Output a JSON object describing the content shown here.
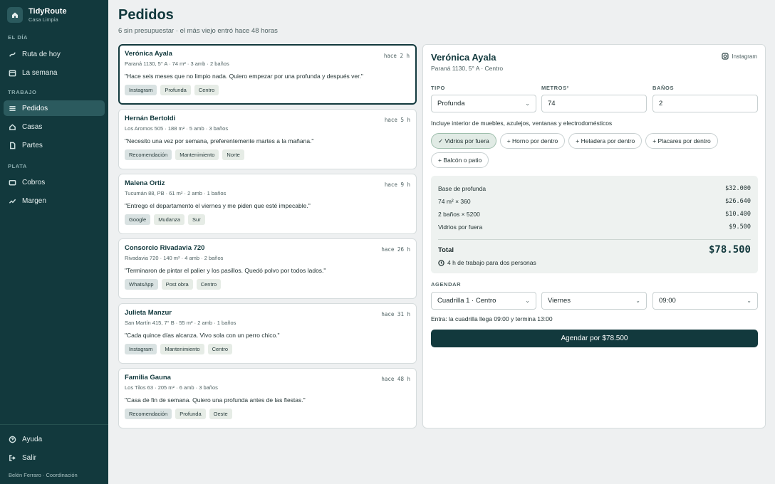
{
  "brand": {
    "name": "TidyRoute",
    "sub": "Casa Limpia"
  },
  "nav": {
    "sections": {
      "dia": "EL DÍA",
      "trabajo": "TRABAJO",
      "plata": "PLATA"
    },
    "ruta": "Ruta de hoy",
    "semana": "La semana",
    "pedidos": "Pedidos",
    "casas": "Casas",
    "partes": "Partes",
    "cobros": "Cobros",
    "margen": "Margen",
    "ayuda": "Ayuda",
    "salir": "Salir",
    "user": "Belén Ferraro · Coordinación"
  },
  "header": {
    "title": "Pedidos",
    "subtitle": "6 sin presupuestar · el más viejo entró hace 48 horas"
  },
  "requests": [
    {
      "name": "Verónica Ayala",
      "addr": "Paraná 1130, 5° A · 74 m² · 3 amb · 2 baños",
      "time": "hace  2  h",
      "quote": "\"Hace seis meses que no limpio nada. Quiero empezar por una profunda y después ver.\"",
      "tags": [
        "Instagram",
        "Profunda",
        "Centro"
      ]
    },
    {
      "name": "Hernán Bertoldi",
      "addr": "Los Aromos 505 · 188 m² · 5 amb · 3 baños",
      "time": "hace  5  h",
      "quote": "\"Necesito una vez por semana, preferentemente martes a la mañana.\"",
      "tags": [
        "Recomendación",
        "Mantenimiento",
        "Norte"
      ]
    },
    {
      "name": "Malena Ortiz",
      "addr": "Tucumán 88, PB · 61 m² · 2 amb · 1 baños",
      "time": "hace  9  h",
      "quote": "\"Entrego el departamento el viernes y me piden que esté impecable.\"",
      "tags": [
        "Google",
        "Mudanza",
        "Sur"
      ]
    },
    {
      "name": "Consorcio Rivadavia 720",
      "addr": "Rivadavia 720 · 140 m² · 4 amb · 2 baños",
      "time": "hace  26  h",
      "quote": "\"Terminaron de pintar el palier y los pasillos. Quedó polvo por todos lados.\"",
      "tags": [
        "WhatsApp",
        "Post obra",
        "Centro"
      ]
    },
    {
      "name": "Julieta Manzur",
      "addr": "San Martín 415, 7° B · 55 m² · 2 amb · 1 baños",
      "time": "hace  31  h",
      "quote": "\"Cada quince días alcanza. Vivo sola con un perro chico.\"",
      "tags": [
        "Instagram",
        "Mantenimiento",
        "Centro"
      ]
    },
    {
      "name": "Familia Gauna",
      "addr": "Los Tilos 63 · 205 m² · 6 amb · 3 baños",
      "time": "hace  48  h",
      "quote": "\"Casa de fin de semana. Quiero una profunda antes de las fiestas.\"",
      "tags": [
        "Recomendación",
        "Profunda",
        "Oeste"
      ]
    }
  ],
  "detail": {
    "name": "Verónica Ayala",
    "addr": "Paraná 1130, 5° A · Centro",
    "source": "Instagram",
    "labels": {
      "tipo": "TIPO",
      "metros": "METROS²",
      "banos": "BAÑOS",
      "agendar": "AGENDAR"
    },
    "tipo": "Profunda",
    "metros": "74",
    "banos": "2",
    "includes": "Incluye interior de muebles, azulejos, ventanas y electrodomésticos",
    "extras": [
      {
        "label": "✓ Vidrios por fuera",
        "on": true
      },
      {
        "label": "+ Horno por dentro",
        "on": false
      },
      {
        "label": "+ Heladera por dentro",
        "on": false
      },
      {
        "label": "+ Placares por dentro",
        "on": false
      },
      {
        "label": "+ Balcón o patio",
        "on": false
      }
    ],
    "quote": {
      "base_label": "Base de profunda",
      "base": "$32.000",
      "m2_label": "74 m² × 360",
      "m2": "$26.640",
      "banos_label": "2 baños × 5200",
      "banos": "$10.400",
      "vidrios_label": "Vidrios por fuera",
      "vidrios": "$9.500",
      "total_label": "Total",
      "total": "$78.500",
      "hours": "4 h de trabajo para dos personas"
    },
    "crew": "Cuadrilla 1 · Centro",
    "day": "Viernes",
    "time": "09:00",
    "entra": "Entra: la cuadrilla llega 09:00 y termina 13:00",
    "cta": "Agendar por $78.500"
  },
  "colors": {
    "sidebar": "#12393d",
    "accent": "#12393d",
    "chip_on": "#e1ebe5"
  }
}
